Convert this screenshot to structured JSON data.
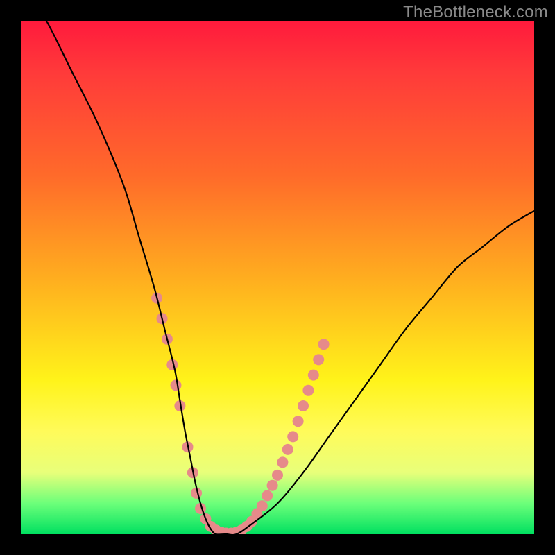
{
  "watermark": "TheBottleneck.com",
  "chart_data": {
    "type": "line",
    "title": "",
    "xlabel": "",
    "ylabel": "",
    "xlim": [
      0,
      100
    ],
    "ylim": [
      0,
      100
    ],
    "grid": false,
    "legend": false,
    "background_gradient": {
      "top": "#ff1a3c",
      "upper_mid": "#ffad1f",
      "mid": "#fff31a",
      "lower_mid": "#e8ff7a",
      "bottom": "#00e060"
    },
    "series": [
      {
        "name": "bottleneck-curve",
        "color": "#000000",
        "x": [
          0,
          5,
          10,
          15,
          20,
          23,
          26,
          28,
          30,
          31,
          32,
          33,
          34,
          35,
          36,
          37,
          38,
          40,
          42,
          45,
          50,
          55,
          60,
          65,
          70,
          75,
          80,
          85,
          90,
          95,
          100
        ],
        "y": [
          108,
          100,
          90,
          80,
          68,
          58,
          48,
          40,
          32,
          26,
          20,
          15,
          10,
          6,
          3,
          1,
          0,
          0,
          0,
          2,
          6,
          12,
          19,
          26,
          33,
          40,
          46,
          52,
          56,
          60,
          63
        ]
      }
    ],
    "markers": [
      {
        "name": "highlight-points",
        "color": "#e68a8a",
        "radius": 8,
        "points": [
          {
            "x": 26.5,
            "y": 46
          },
          {
            "x": 27.5,
            "y": 42
          },
          {
            "x": 28.5,
            "y": 38
          },
          {
            "x": 29.5,
            "y": 33
          },
          {
            "x": 30.2,
            "y": 29
          },
          {
            "x": 31.0,
            "y": 25
          },
          {
            "x": 32.5,
            "y": 17
          },
          {
            "x": 33.5,
            "y": 12
          },
          {
            "x": 34.2,
            "y": 8
          },
          {
            "x": 35.0,
            "y": 5
          },
          {
            "x": 36.0,
            "y": 3
          },
          {
            "x": 37.0,
            "y": 1.5
          },
          {
            "x": 38.0,
            "y": 0.8
          },
          {
            "x": 39.0,
            "y": 0.4
          },
          {
            "x": 40.0,
            "y": 0.2
          },
          {
            "x": 41.0,
            "y": 0.2
          },
          {
            "x": 42.0,
            "y": 0.4
          },
          {
            "x": 43.0,
            "y": 0.8
          },
          {
            "x": 44.0,
            "y": 1.5
          },
          {
            "x": 45.0,
            "y": 2.5
          },
          {
            "x": 46.0,
            "y": 4
          },
          {
            "x": 47.0,
            "y": 5.5
          },
          {
            "x": 48.0,
            "y": 7.5
          },
          {
            "x": 49.0,
            "y": 9.5
          },
          {
            "x": 50.0,
            "y": 11.5
          },
          {
            "x": 51.0,
            "y": 14
          },
          {
            "x": 52.0,
            "y": 16.5
          },
          {
            "x": 53.0,
            "y": 19
          },
          {
            "x": 54.0,
            "y": 22
          },
          {
            "x": 55.0,
            "y": 25
          },
          {
            "x": 56.0,
            "y": 28
          },
          {
            "x": 57.0,
            "y": 31
          },
          {
            "x": 58.0,
            "y": 34
          },
          {
            "x": 59.0,
            "y": 37
          }
        ]
      }
    ]
  }
}
